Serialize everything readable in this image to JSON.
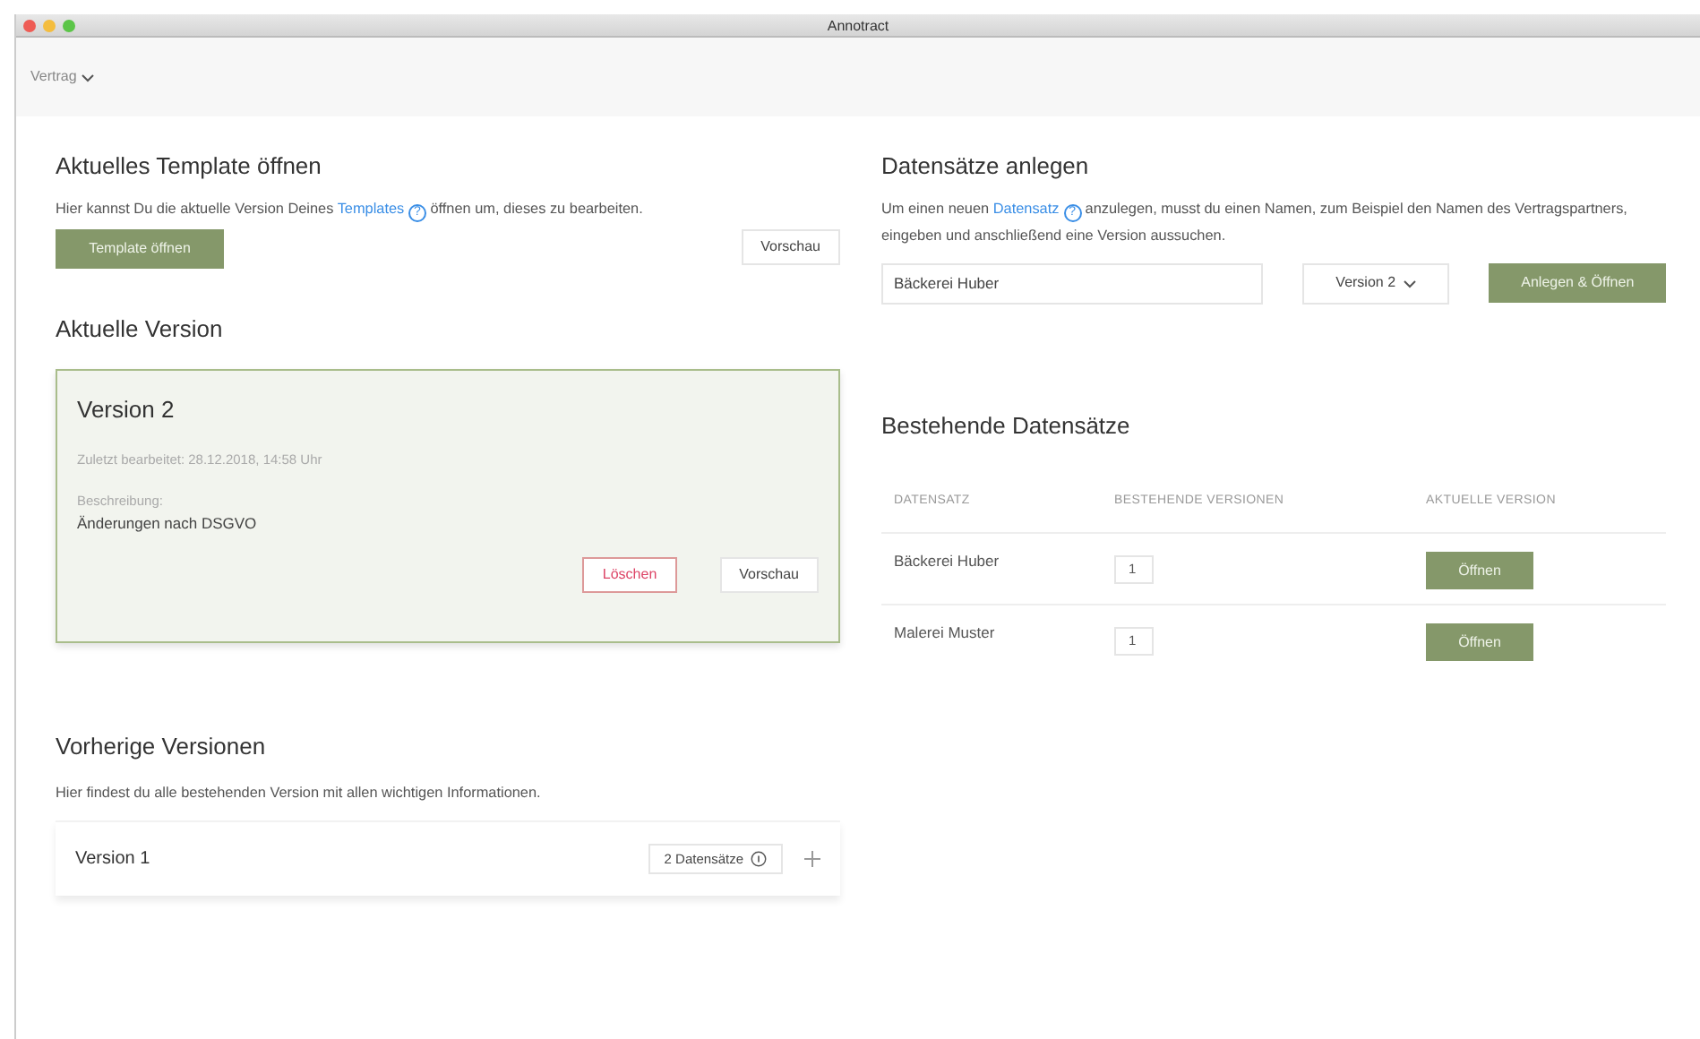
{
  "window": {
    "title": "Annotract"
  },
  "toolbar": {
    "menu": "Vertrag",
    "expanded": false
  },
  "template_section": {
    "title": "Aktuelles Template öffnen",
    "text_before": "Hier kannst Du die aktuelle Version Deines ",
    "link": "Templates",
    "help_mark": "?",
    "text_after": " öffnen um, dieses zu bearbeiten.",
    "open_button": "Template öffnen",
    "preview_button": "Vorschau"
  },
  "current_version": {
    "title": "Aktuelle Version",
    "version": "Version 2",
    "edited": "Zuletzt bearbeitet: 28.12.2018, 14:58 Uhr",
    "description_label": "Beschreibung:",
    "description": "Änderungen nach DSGVO",
    "delete_button": "Löschen",
    "preview_button": "Vorschau"
  },
  "previous_versions": {
    "title": "Vorherige Versionen",
    "text": "Hier findest du alle bestehenden Version mit allen wichtigen Informationen.",
    "items": [
      {
        "name": "Version 1",
        "badge": "2 Datensätze",
        "expanded": false
      }
    ]
  },
  "create_section": {
    "title": "Datensätze anlegen",
    "text_before": "Um einen neuen ",
    "link": "Datensatz",
    "help_mark": "?",
    "text_after": " anzulegen, musst du einen Namen, zum Beispiel den Namen des Vertragspartners, eingeben und anschließend eine Version aussuchen.",
    "name_value": "Bäckerei Huber",
    "version_select": "Version 2",
    "submit_button": "Anlegen & Öffnen"
  },
  "records": {
    "title": "Bestehende Datensätze",
    "columns": [
      "DATENSATZ",
      "BESTEHENDE VERSIONEN",
      "AKTUELLE VERSION"
    ],
    "rows": [
      {
        "name": "Bäckerei Huber",
        "versions": "1",
        "action": "Öffnen"
      },
      {
        "name": "Malerei Muster",
        "versions": "1",
        "action": "Öffnen"
      }
    ]
  }
}
